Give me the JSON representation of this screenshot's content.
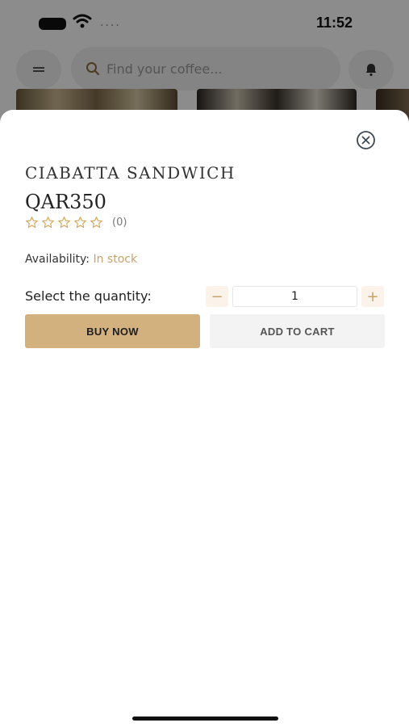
{
  "status_bar": {
    "time": "11:52",
    "signal_dots": "...."
  },
  "background": {
    "search": {
      "placeholder": "Find your coffee..."
    }
  },
  "sheet": {
    "product_name": "CIABATTA SANDWICH",
    "price": "QAR350",
    "rating": {
      "stars": 0,
      "max_stars": 5,
      "count_text": "(0)"
    },
    "availability": {
      "label": "Availability:",
      "value": "In stock"
    },
    "quantity": {
      "label": "Select the quantity:",
      "value": "1",
      "minus_symbol": "−",
      "plus_symbol": "+"
    },
    "buy_now_label": "BUY NOW",
    "add_to_cart_label": "ADD TO CART"
  },
  "colors": {
    "accent": "#d3b17f",
    "stock": "#c7a26c",
    "secondary_button": "#f3f3f3"
  },
  "icons": [
    "close-icon",
    "star-outline-icon",
    "search-icon",
    "bell-icon",
    "menu-icon",
    "wifi-icon",
    "battery-icon"
  ]
}
